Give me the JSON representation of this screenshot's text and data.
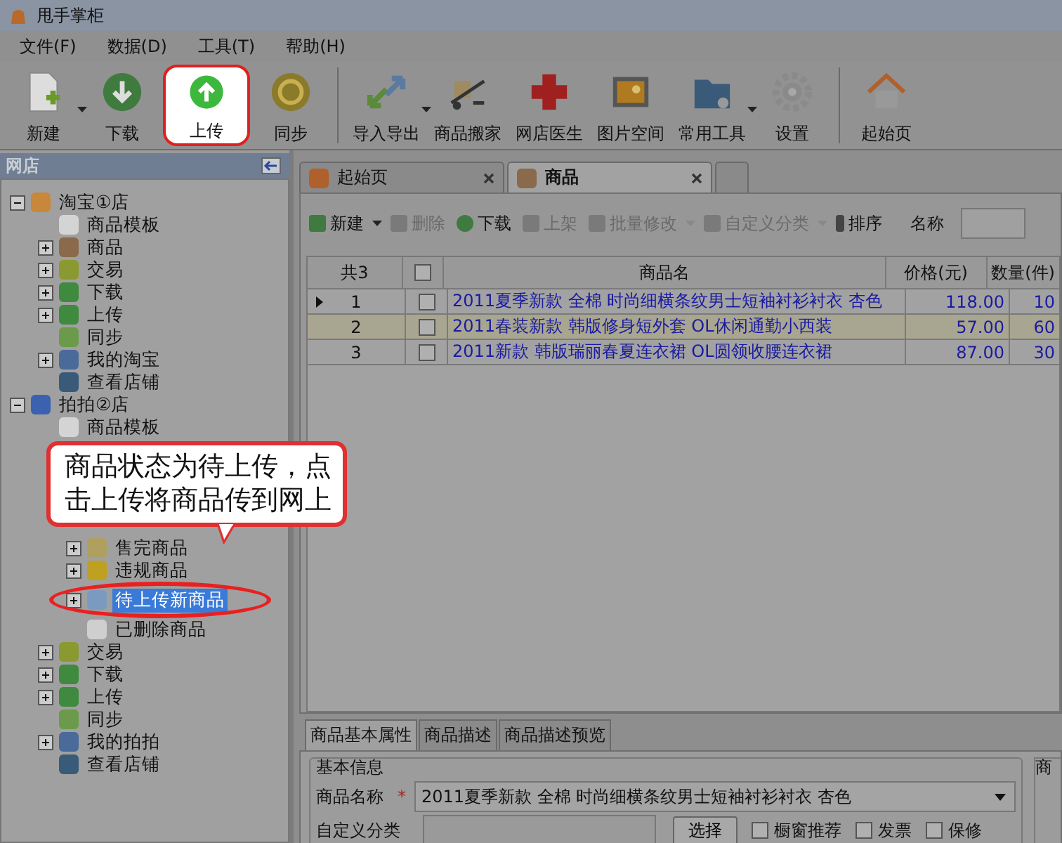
{
  "window": {
    "title": "甩手掌柜"
  },
  "menu": [
    "文件(F)",
    "数据(D)",
    "工具(T)",
    "帮助(H)"
  ],
  "toolbar": [
    {
      "label": "新建",
      "kind": "new",
      "dropdown": true,
      "highlighted": false
    },
    {
      "label": "下载",
      "kind": "download",
      "dropdown": false,
      "highlighted": false
    },
    {
      "label": "上传",
      "kind": "upload",
      "dropdown": false,
      "highlighted": true
    },
    {
      "label": "同步",
      "kind": "sync",
      "dropdown": false,
      "highlighted": false
    },
    {
      "label": "导入导出",
      "kind": "transfer",
      "dropdown": true,
      "highlighted": false
    },
    {
      "label": "商品搬家",
      "kind": "truck",
      "dropdown": false,
      "highlighted": false
    },
    {
      "label": "网店医生",
      "kind": "cross",
      "dropdown": false,
      "highlighted": false
    },
    {
      "label": "图片空间",
      "kind": "picture",
      "dropdown": false,
      "highlighted": false
    },
    {
      "label": "常用工具",
      "kind": "folder",
      "dropdown": true,
      "highlighted": false
    },
    {
      "label": "设置",
      "kind": "gear",
      "dropdown": false,
      "highlighted": false
    },
    {
      "label": "起始页",
      "kind": "home",
      "dropdown": false,
      "highlighted": false
    }
  ],
  "sidebar": {
    "title": "网店",
    "tree": [
      {
        "label": "淘宝①店",
        "kind": "taobao",
        "expanded": true,
        "children": [
          {
            "label": "商品模板",
            "kind": "template"
          },
          {
            "label": "商品",
            "kind": "box",
            "expanded": false
          },
          {
            "label": "交易",
            "kind": "yen",
            "expanded": false
          },
          {
            "label": "下载",
            "kind": "download",
            "expanded": false
          },
          {
            "label": "上传",
            "kind": "upload",
            "expanded": false
          },
          {
            "label": "同步",
            "kind": "sync"
          },
          {
            "label": "我的淘宝",
            "kind": "network",
            "expanded": false
          },
          {
            "label": "查看店铺",
            "kind": "globe"
          }
        ]
      },
      {
        "label": "拍拍②店",
        "kind": "paipai",
        "expanded": true,
        "children": [
          {
            "label": "商品模板",
            "kind": "template"
          },
          {
            "children": [
              {
                "label": "售完商品",
                "kind": "warning",
                "expanded": false,
                "selected": false
              },
              {
                "label": "违规商品",
                "kind": "alert",
                "expanded": false,
                "selected": false
              },
              {
                "label": "待上传新商品",
                "kind": "pending",
                "expanded": false,
                "selected": true
              },
              {
                "label": "已删除商品",
                "kind": "trash",
                "selected": false
              }
            ]
          },
          {
            "label": "交易",
            "kind": "yen",
            "expanded": false
          },
          {
            "label": "下载",
            "kind": "download",
            "expanded": false
          },
          {
            "label": "上传",
            "kind": "upload",
            "expanded": false
          },
          {
            "label": "同步",
            "kind": "sync"
          },
          {
            "label": "我的拍拍",
            "kind": "network",
            "expanded": false
          },
          {
            "label": "查看店铺",
            "kind": "globe"
          }
        ]
      }
    ]
  },
  "callout": {
    "text": "商品状态为待上传，点击上传将商品传到网上"
  },
  "tabs": [
    {
      "label": "起始页",
      "kind": "home",
      "selected": false
    },
    {
      "label": "商品",
      "kind": "box",
      "selected": true
    }
  ],
  "list_toolbar": [
    {
      "label": "新建",
      "kind": "add",
      "disabled": false,
      "dropdown": true
    },
    {
      "label": "删除",
      "kind": "delete",
      "disabled": true,
      "dropdown": false
    },
    {
      "label": "下载",
      "kind": "download",
      "disabled": false,
      "dropdown": false
    },
    {
      "label": "上架",
      "kind": "up",
      "disabled": true,
      "dropdown": false
    },
    {
      "label": "批量修改",
      "kind": "batch",
      "disabled": true,
      "dropdown": true
    },
    {
      "label": "自定义分类",
      "kind": "category",
      "disabled": true,
      "dropdown": true
    },
    {
      "label": "排序",
      "kind": "sort",
      "disabled": false,
      "dropdown": false
    }
  ],
  "search": {
    "label": "名称"
  },
  "table": {
    "count": "共3",
    "all_checked": false,
    "columns": [
      "商品名",
      "价格(元)",
      "数量(件)"
    ],
    "rows": [
      {
        "index": "1",
        "current": true,
        "checked": false,
        "name": "2011夏季新款 全棉 时尚细横条纹男士短袖衬衫衬衣 杏色",
        "price": "118.00",
        "quantity": "10"
      },
      {
        "index": "2",
        "current": false,
        "checked": false,
        "name": "2011春装新款 韩版修身短外套 OL休闲通勤小西装",
        "price": "57.00",
        "quantity": "60"
      },
      {
        "index": "3",
        "current": false,
        "checked": false,
        "name": "2011新款 韩版瑞丽春夏连衣裙 OL圆领收腰连衣裙",
        "price": "87.00",
        "quantity": "30"
      }
    ]
  },
  "detail": {
    "tabs": [
      {
        "label": "商品基本属性",
        "selected": true
      },
      {
        "label": "商品描述",
        "selected": false
      },
      {
        "label": "商品描述预览",
        "selected": false
      }
    ],
    "group": "基本信息",
    "name_label": "商品名称",
    "required_mark": "*",
    "name_value": "2011夏季新款 全棉 时尚细横条纹男士短袖衬衫衬衣 杏色",
    "category_label": "自定义分类",
    "select_button": "选择",
    "options": [
      {
        "label": "橱窗推荐",
        "checked": false
      },
      {
        "label": "发票",
        "checked": false
      },
      {
        "label": "保修",
        "checked": false
      }
    ],
    "side_group": "商"
  }
}
